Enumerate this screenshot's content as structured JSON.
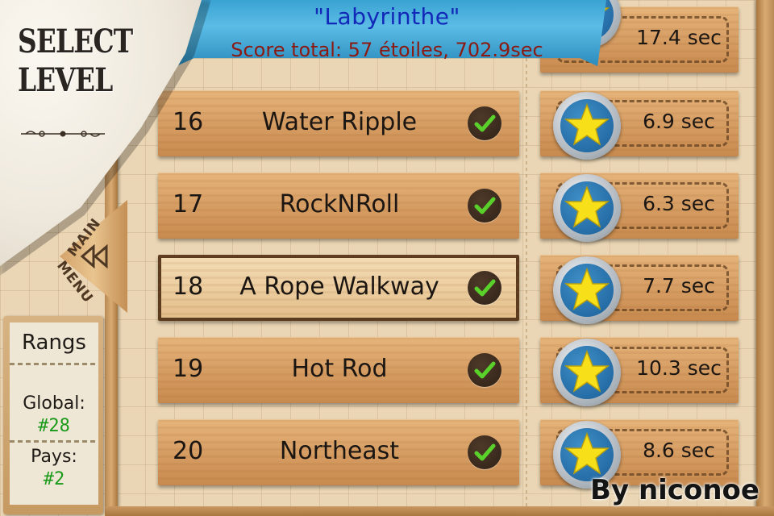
{
  "header": {
    "screen_title_line1": "SELECT",
    "screen_title_line2": "LEVEL",
    "banner_title": "\"Labyrinthe\"",
    "banner_score": "Score total:  57 étoiles, 702.9sec"
  },
  "main_menu": {
    "label_top": "MAIN",
    "label_bottom": "MENU",
    "icon": "double-left-arrow-icon"
  },
  "ranks": {
    "title": "Rangs",
    "global_label": "Global:",
    "global_value": "#28",
    "country_label": "Pays:",
    "country_value": "#2"
  },
  "levels": [
    {
      "number": "16",
      "name": "Water Ripple",
      "completed": true,
      "stars": 1,
      "time": "6.9 sec",
      "selected": false
    },
    {
      "number": "17",
      "name": "RockNRoll",
      "completed": true,
      "stars": 1,
      "time": "6.3 sec",
      "selected": false
    },
    {
      "number": "18",
      "name": "A Rope Walkway",
      "completed": true,
      "stars": 1,
      "time": "7.7 sec",
      "selected": true
    },
    {
      "number": "19",
      "name": "Hot Rod",
      "completed": true,
      "stars": 1,
      "time": "10.3 sec",
      "selected": false
    },
    {
      "number": "20",
      "name": "Northeast",
      "completed": true,
      "stars": 1,
      "time": "8.6 sec",
      "selected": false
    }
  ],
  "partial_top_row": {
    "time": "17.4 sec"
  },
  "credit": "By niconoe",
  "colors": {
    "banner": "#3aa3d2",
    "banner_title": "#1228b8",
    "banner_score": "#8b1a12",
    "check": "#5ad02a",
    "star": "#f7e01a",
    "rank_value": "#1a9a1a"
  }
}
